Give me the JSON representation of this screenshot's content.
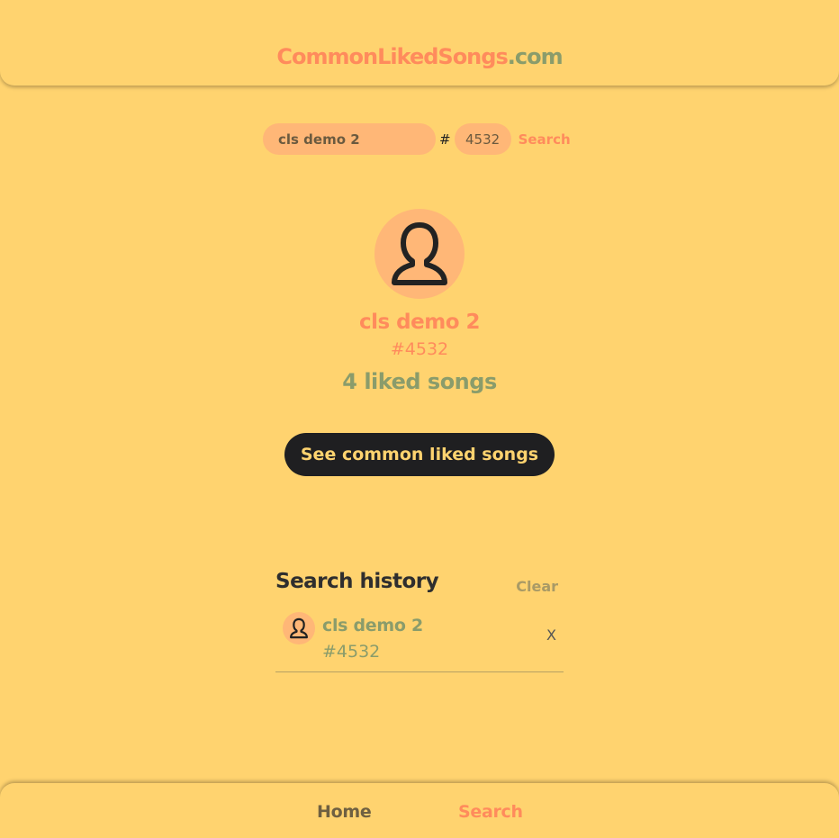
{
  "header": {
    "logo_main": "CommonLikedSongs",
    "logo_tld": ".com"
  },
  "search": {
    "name_value": "cls demo 2",
    "hash_symbol": "#",
    "tag_value": "4532",
    "button_label": "Search"
  },
  "profile": {
    "avatar_icon": "user-icon",
    "name": "cls demo 2",
    "tag": "#4532",
    "liked_count_text": "4 liked songs",
    "common_button_label": "See common liked songs"
  },
  "history": {
    "title": "Search history",
    "clear_label": "Clear",
    "items": [
      {
        "name": "cls demo 2",
        "tag": "#4532",
        "remove_label": "X",
        "icon": "user-icon"
      }
    ]
  },
  "nav": {
    "home_label": "Home",
    "search_label": "Search",
    "active": "Search"
  },
  "colors": {
    "background": "#ffd36f",
    "accent": "#ff8b5c",
    "input_bg": "#ffb777",
    "green": "#8a9c6b",
    "dark": "#1f1f21"
  }
}
